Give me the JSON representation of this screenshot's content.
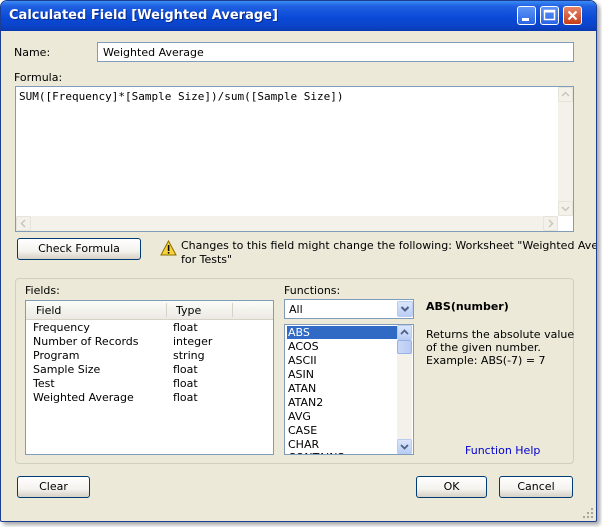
{
  "window": {
    "title": "Calculated Field [Weighted Average]"
  },
  "name": {
    "label": "Name:",
    "value": "Weighted Average"
  },
  "formula": {
    "label": "Formula:",
    "value": "SUM([Frequency]*[Sample Size])/sum([Sample Size])"
  },
  "check_button": "Check Formula",
  "warning": {
    "icon": "warning-icon",
    "line1": "Changes to this field might change the following: Worksheet \"Weighted Average",
    "line2": "for Tests\""
  },
  "fields": {
    "label": "Fields:",
    "headers": {
      "field": "Field",
      "type": "Type"
    },
    "rows": [
      {
        "name": "Frequency",
        "type": "float"
      },
      {
        "name": "Number of Records",
        "type": "integer"
      },
      {
        "name": "Program",
        "type": "string"
      },
      {
        "name": "Sample Size",
        "type": "float"
      },
      {
        "name": "Test",
        "type": "float"
      },
      {
        "name": "Weighted Average",
        "type": "float"
      }
    ]
  },
  "functions": {
    "label": "Functions:",
    "filter_value": "All",
    "items": [
      "ABS",
      "ACOS",
      "ASCII",
      "ASIN",
      "ATAN",
      "ATAN2",
      "AVG",
      "CASE",
      "CHAR",
      "CONTAINS"
    ],
    "selected": "ABS"
  },
  "help": {
    "signature": "ABS(number)",
    "description_lines": [
      "Returns the absolute value",
      "of the given number.",
      "Example: ABS(-7) = 7"
    ],
    "link_text": "Function Help"
  },
  "buttons": {
    "clear": "Clear",
    "ok": "OK",
    "cancel": "Cancel"
  },
  "colors": {
    "titlebar": "#0a4ad8",
    "selection": "#316ac5",
    "link": "#0000cc",
    "dialog_bg": "#ece9d8"
  }
}
